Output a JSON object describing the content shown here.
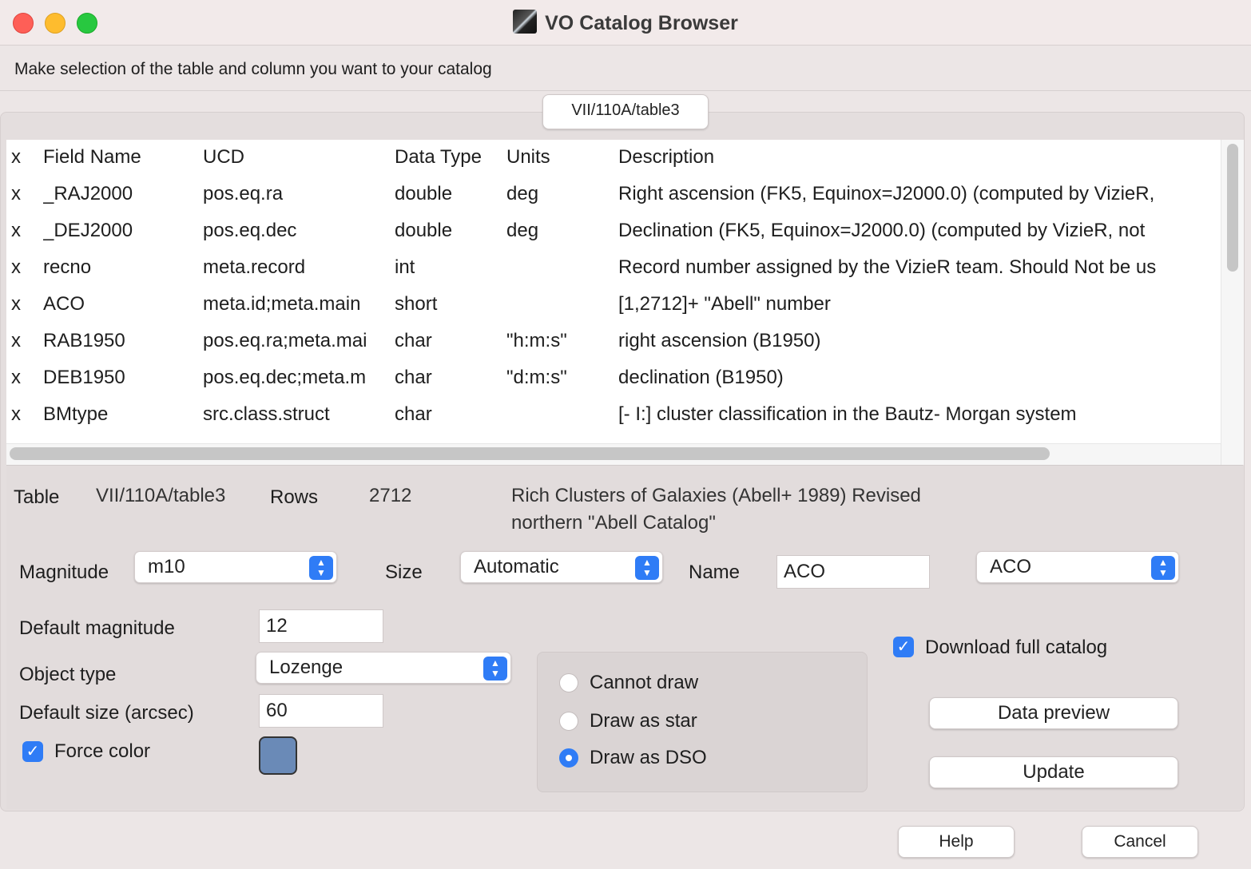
{
  "window": {
    "title": "VO Catalog Browser",
    "traffic_lights": {
      "close": "#fe5f57",
      "minimize": "#febc2e",
      "zoom": "#28c840"
    }
  },
  "instruction": "Make selection of the table and column you want to your catalog",
  "tab": {
    "label": "VII/110A/table3"
  },
  "columns_table": {
    "headers": [
      "x",
      "Field Name",
      "UCD",
      "Data Type",
      "Units",
      "Description"
    ],
    "rows": [
      [
        "x",
        "_RAJ2000",
        "pos.eq.ra",
        "double",
        "deg",
        "Right ascension (FK5, Equinox=J2000.0) (computed by VizieR,"
      ],
      [
        "x",
        "_DEJ2000",
        "pos.eq.dec",
        "double",
        "deg",
        "Declination (FK5, Equinox=J2000.0) (computed by VizieR, not"
      ],
      [
        "x",
        "recno",
        "meta.record",
        "int",
        "",
        "Record number assigned by the VizieR team. Should Not be us"
      ],
      [
        "x",
        "ACO",
        "meta.id;meta.main",
        "short",
        "",
        "[1,2712]+ \"Abell\" number"
      ],
      [
        "x",
        "RAB1950",
        "pos.eq.ra;meta.mai",
        "char",
        "\"h:m:s\"",
        "right ascension (B1950)"
      ],
      [
        "x",
        "DEB1950",
        "pos.eq.dec;meta.m",
        "char",
        "\"d:m:s\"",
        "declination (B1950)"
      ],
      [
        "x",
        "BMtype",
        "src.class.struct",
        "char",
        "",
        "[- I:] cluster classification in the Bautz- Morgan system"
      ]
    ]
  },
  "info": {
    "table_label": "Table",
    "table_value": "VII/110A/table3",
    "rows_label": "Rows",
    "rows_value": "2712",
    "description_line1": "Rich Clusters of Galaxies (Abell+ 1989) Revised",
    "description_line2": "northern \"Abell Catalog\""
  },
  "fields": {
    "magnitude_label": "Magnitude",
    "magnitude_value": "m10",
    "size_label": "Size",
    "size_value": "Automatic",
    "name_label": "Name",
    "name_input": "ACO",
    "name_select": "ACO",
    "default_magnitude_label": "Default magnitude",
    "default_magnitude_value": "12",
    "object_type_label": "Object type",
    "object_type_value": "Lozenge",
    "default_size_label": "Default size (arcsec)",
    "default_size_value": "60",
    "force_color_label": "Force color",
    "force_color_checked": true,
    "force_color_value": "#6a8ab7"
  },
  "draw_mode": {
    "options": [
      "Cannot draw",
      "Draw as star",
      "Draw as DSO"
    ],
    "selected": "Draw as DSO"
  },
  "download": {
    "label": "Download full catalog",
    "checked": true
  },
  "buttons": {
    "data_preview": "Data preview",
    "update": "Update",
    "help": "Help",
    "cancel": "Cancel"
  },
  "accent_color": "#2f7cf6"
}
